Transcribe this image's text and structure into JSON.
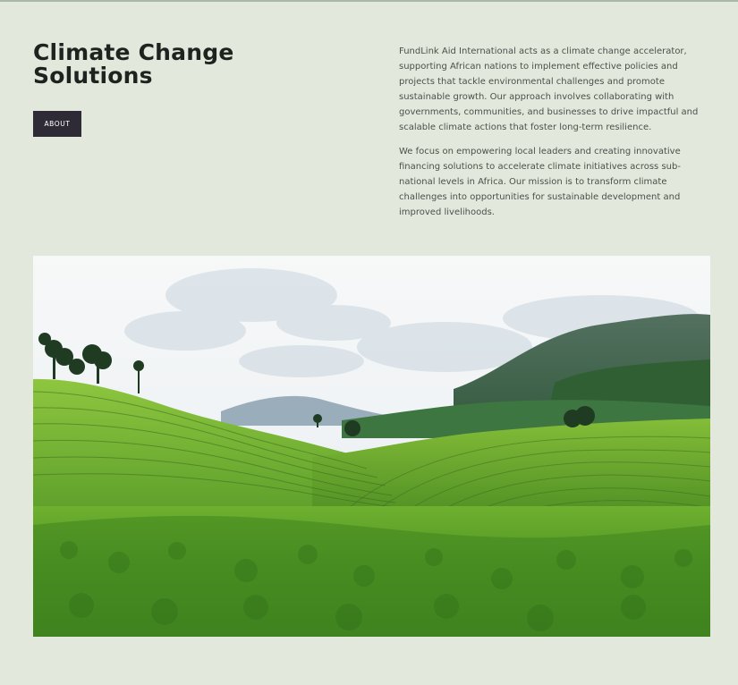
{
  "page": {
    "heading": "Climate Change Solutions",
    "button_label": "ABOUT",
    "paragraphs": [
      "FundLink Aid International acts as a climate change accelerator, supporting African nations to implement effective policies and projects that tackle environmental challenges and promote sustainable growth. Our approach involves collaborating with governments, communities, and businesses to drive impactful and scalable climate actions that foster long-term resilience.",
      "We focus on empowering local leaders and creating innovative financing solutions to accelerate climate initiatives across sub-national levels in Africa. Our mission is to transform climate challenges into opportunities for sustainable development and improved livelihoods."
    ]
  },
  "colors": {
    "background": "#e2e9dc",
    "button": "#2f2b36",
    "heading": "#1f231f",
    "body_text": "#4b504b"
  },
  "hero": {
    "icon": "tea-plantation-landscape"
  }
}
